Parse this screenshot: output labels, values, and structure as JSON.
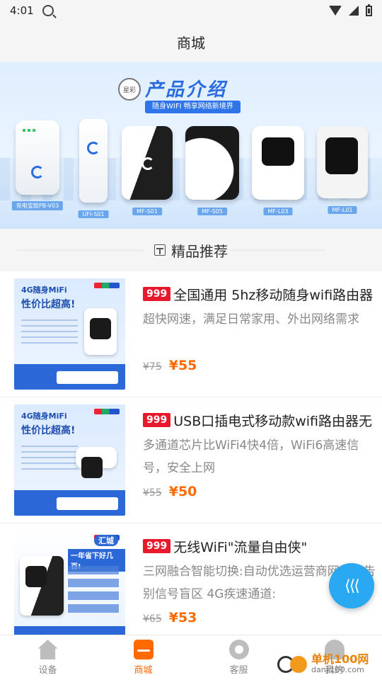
{
  "status": {
    "time": "4:01"
  },
  "header": {
    "title": "商城"
  },
  "banner": {
    "logo_text": "星彩",
    "title": "产品介绍",
    "subtitle": "随身WIFI 畅享网络新境界",
    "products": [
      {
        "caption": "充电宝款PB-V03"
      },
      {
        "caption": "UFI-S01"
      },
      {
        "caption": "MF-S01"
      },
      {
        "caption": "MF-S05"
      },
      {
        "caption": "MF-L03"
      },
      {
        "caption": "MF-L01"
      }
    ]
  },
  "section": {
    "title": "精品推荐"
  },
  "products": [
    {
      "tag": "999",
      "title": "全国通用 5hz移动随身wifi路由器",
      "desc": "超快网速，满足日常家用、外出网络需求",
      "old_price": "¥75",
      "price": "¥55",
      "thumb_head": "4G随身MiFi",
      "thumb_big": "性价比超高!"
    },
    {
      "tag": "999",
      "title": "USB口插电式移动款wifi路由器无",
      "desc": "多通道芯片比WiFi4快4倍，WiFi6高速信号，安全上网",
      "old_price": "¥55",
      "price": "¥50",
      "thumb_head": "4G随身MiFi",
      "thumb_big": "性价比超高!"
    },
    {
      "tag": "999",
      "title": "无线WiFi\"流量自由侠\"",
      "desc": "三网融合智能切换:自动优选运营商网络，告别信号盲区 4G疾速通道:",
      "old_price": "¥65",
      "price": "¥53",
      "thumb_head": "一年省下好几百!",
      "thumb_big": "汇城"
    }
  ],
  "tabs": [
    {
      "label": "设备",
      "icon": "home-icon"
    },
    {
      "label": "商城",
      "icon": "shop-icon"
    },
    {
      "label": "客服",
      "icon": "service-icon"
    },
    {
      "label": "我的",
      "icon": "user-icon"
    }
  ],
  "watermark": {
    "name": "单机100网",
    "url": "danji100.com"
  },
  "colors": {
    "accent": "#ff6a00",
    "tag": "#e8192c",
    "fab": "#2aa8f2"
  }
}
